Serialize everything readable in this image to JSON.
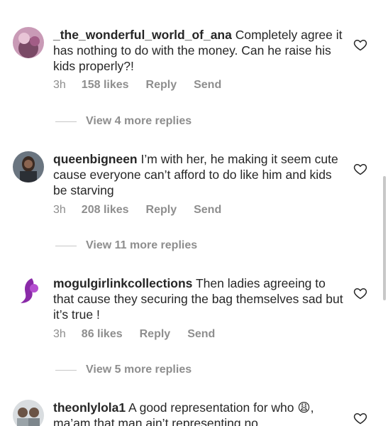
{
  "comments": [
    {
      "username": "_the_wonderful_world_of_ana",
      "text": "Completely agree it has nothing to do with the money. Can he raise his kids properly?!",
      "time": "3h",
      "likes": "158 likes",
      "reply": "Reply",
      "send": "Send",
      "view_replies": "View 4 more replies"
    },
    {
      "username": "queenbigneen",
      "text": "I’m with her, he making it seem cute cause everyone can’t afford to do like him and kids be starving",
      "time": "3h",
      "likes": "208 likes",
      "reply": "Reply",
      "send": "Send",
      "view_replies": "View 11 more replies"
    },
    {
      "username": "mogulgirlinkcollections",
      "text": "Then ladies agreeing to that cause they securing the bag themselves sad but it’s true !",
      "time": "3h",
      "likes": "86 likes",
      "reply": "Reply",
      "send": "Send",
      "view_replies": "View 5 more replies"
    },
    {
      "username": "theonlylola1",
      "text": "A good representation for who 😩, ma’am that man ain’t representing no"
    }
  ],
  "icons": {
    "like": "heart-outline-icon"
  }
}
